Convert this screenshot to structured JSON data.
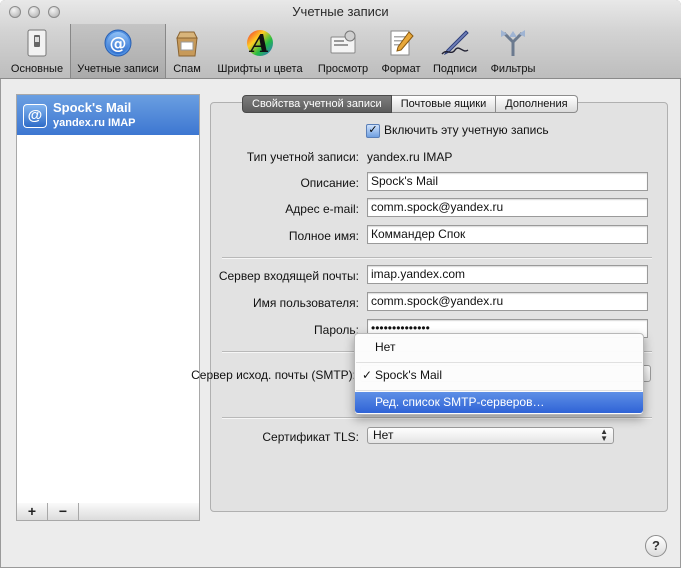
{
  "window": {
    "title": "Учетные записи"
  },
  "toolbar": {
    "items": [
      {
        "label": "Основные",
        "icon": "switch-icon"
      },
      {
        "label": "Учетные записи",
        "icon": "at-sign-icon"
      },
      {
        "label": "Спам",
        "icon": "junk-bag-icon"
      },
      {
        "label": "Шрифты и цвета",
        "icon": "font-a-icon"
      },
      {
        "label": "Просмотр",
        "icon": "viewing-icon"
      },
      {
        "label": "Формат",
        "icon": "compose-pencil-icon"
      },
      {
        "label": "Подписи",
        "icon": "signature-pen-icon"
      },
      {
        "label": "Фильтры",
        "icon": "filter-arrows-icon"
      }
    ],
    "active_index": 1
  },
  "accounts": {
    "items": [
      {
        "name": "Spock's Mail",
        "type": "yandex.ru IMAP"
      }
    ],
    "add_label": "+",
    "remove_label": "−"
  },
  "tabs": [
    {
      "label": "Свойства учетной записи",
      "selected": true
    },
    {
      "label": "Почтовые ящики",
      "selected": false
    },
    {
      "label": "Дополнения",
      "selected": false
    }
  ],
  "form": {
    "enable_label": "Включить эту учетную запись",
    "enable_checked": true,
    "type_label": "Тип учетной записи:",
    "type_value": "yandex.ru IMAP",
    "description_label": "Описание:",
    "description_value": "Spock's Mail",
    "email_label": "Адрес e-mail:",
    "email_value": "comm.spock@yandex.ru",
    "fullname_label": "Полное имя:",
    "fullname_value": "Коммандер Спок",
    "incoming_label": "Сервер входящей почты:",
    "incoming_value": "imap.yandex.com",
    "username_label": "Имя пользователя:",
    "username_value": "comm.spock@yandex.ru",
    "password_label": "Пароль:",
    "password_value": "••••••••••••••",
    "smtp_label": "Сервер исход. почты (SMTP):",
    "tls_label": "Сертификат TLS:",
    "tls_value": "Нет"
  },
  "smtp_menu": {
    "items": [
      {
        "label": "Нет",
        "checked": false,
        "highlighted": false
      },
      {
        "label": "Spock's Mail",
        "checked": true,
        "highlighted": false
      },
      {
        "label": "Ред. список SMTP-серверов…",
        "checked": false,
        "highlighted": true
      }
    ],
    "check_glyph": "✓"
  },
  "help": {
    "label": "?"
  }
}
